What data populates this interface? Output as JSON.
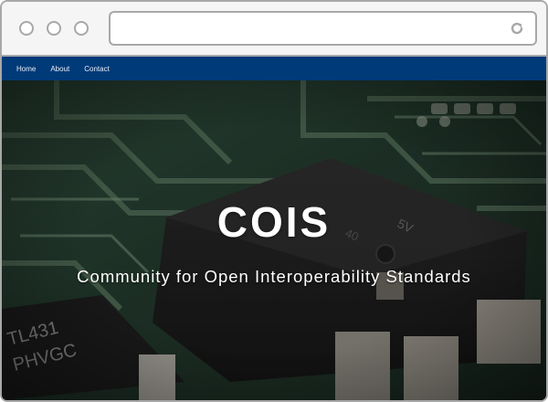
{
  "nav": {
    "links": [
      "Home",
      "About",
      "Contact"
    ]
  },
  "hero": {
    "title": "COIS",
    "subtitle": "Community for Open Interoperability Standards",
    "background": "circuit-board-photo",
    "chip_markings": [
      "5V",
      "40",
      "TL431",
      "PHVGC"
    ]
  },
  "colors": {
    "navbar": "#003a79",
    "chrome_border": "#a8a8a8",
    "hero_text": "#ffffff"
  },
  "icons": [
    "window-dot-icon",
    "reload-icon"
  ]
}
